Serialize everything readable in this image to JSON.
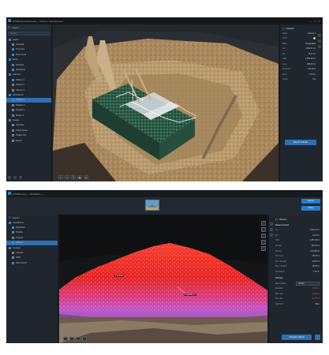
{
  "shot1": {
    "title": "PIX4Dcloud Advanced — Volume measurement",
    "window_controls": [
      "–",
      "□",
      "×"
    ],
    "left_panel": {
      "tab_label": "Layers",
      "search_placeholder": "Search",
      "tree": [
        {
          "label": "Layers",
          "level": 0,
          "checked": true,
          "section": true
        },
        {
          "label": "Imported",
          "level": 1,
          "checked": false
        },
        {
          "label": "Tie points",
          "level": 1,
          "checked": true
        },
        {
          "label": "Point cloud",
          "level": 1,
          "checked": true
        },
        {
          "label": "Mesh",
          "level": 0,
          "checked": true,
          "section": true
        },
        {
          "label": "Textured",
          "level": 1,
          "checked": true
        },
        {
          "label": "Wireframe",
          "level": 1,
          "checked": false
        },
        {
          "label": "Volumes",
          "level": 0,
          "checked": true,
          "section": true
        },
        {
          "label": "Volume 1",
          "level": 1,
          "checked": true
        },
        {
          "label": "Volume 2",
          "level": 1,
          "checked": false
        },
        {
          "label": "Volume 3",
          "level": 1,
          "checked": false
        },
        {
          "label": "Annotations",
          "level": 0,
          "checked": true,
          "section": true
        },
        {
          "label": "Polyline 1",
          "level": 1,
          "checked": true,
          "selected": true
        },
        {
          "label": "Polyline 2",
          "level": 1,
          "checked": false
        },
        {
          "label": "Polygon 1",
          "level": 1,
          "checked": false
        },
        {
          "label": "Marker 1",
          "level": 1,
          "checked": false
        },
        {
          "label": "Images",
          "level": 0,
          "checked": true,
          "section": true
        },
        {
          "label": "Cameras",
          "level": 1,
          "checked": false
        },
        {
          "label": "Orthomosaic",
          "level": 1,
          "checked": false
        },
        {
          "label": "Project info",
          "level": 1,
          "checked": false
        },
        {
          "label": "Export",
          "level": 1,
          "checked": false
        }
      ]
    },
    "viewer_tools": [
      "▸",
      "✦",
      "☰",
      "▣",
      "⊕"
    ],
    "right_panel": {
      "title": "Volume",
      "properties": [
        {
          "k": "Name",
          "v": "Volume 1"
        },
        {
          "k": "Color",
          "v": ""
        },
        {
          "k": "Base",
          "v": "Triangulated"
        },
        {
          "k": "Cut",
          "v": "2 840.31 m³"
        },
        {
          "k": "Fill",
          "v": "12.07 m³"
        },
        {
          "k": "Total",
          "v": "2 852.38 m³"
        },
        {
          "k": "Area",
          "v": "965.25 m²"
        },
        {
          "k": "Perimeter",
          "v": "126.40 m"
        },
        {
          "k": "Error",
          "v": "± 3.5 m³"
        },
        {
          "k": "Visible",
          "v": "Yes"
        }
      ],
      "action_label": "Export volume"
    }
  },
  "shot2": {
    "title": "PIX4Dsurvey — Stockpile — ...",
    "header_buttons": [
      "Export",
      "Share"
    ],
    "left_panel": {
      "tab_label": "Layers",
      "tree": [
        {
          "label": "Annotations",
          "level": 0,
          "section": true,
          "checked": true
        },
        {
          "label": "Inspection",
          "level": 1,
          "checked": true
        },
        {
          "label": "Polyline",
          "level": 1,
          "checked": false
        },
        {
          "label": "Polygon",
          "level": 1,
          "checked": false
        },
        {
          "label": "Volume",
          "level": 1,
          "checked": true,
          "selected": true
        },
        {
          "label": "Geotags",
          "level": 0,
          "section": true,
          "checked": true
        },
        {
          "label": "Camera",
          "level": 1,
          "checked": false
        },
        {
          "label": "DSM",
          "level": 1,
          "checked": false
        },
        {
          "label": "Point Cloud",
          "level": 1,
          "checked": true
        }
      ]
    },
    "viewer": {
      "labels": [
        "1 239.65 m³",
        "Cut area"
      ]
    },
    "right_panel": {
      "title": "Volume",
      "section_title": "Measurements",
      "rows": [
        {
          "k": "Cut",
          "v": "2 840.31 m³",
          "red": false
        },
        {
          "k": "Fill",
          "v": "12.07 m³",
          "red": false
        },
        {
          "k": "Total",
          "v": "2 852.38 m³",
          "red": false
        },
        {
          "k": "2D area",
          "v": "965.25 m²",
          "red": false
        },
        {
          "k": "3D area",
          "v": "1 024.88 m²",
          "red": false
        },
        {
          "k": "Perimeter",
          "v": "126.40 m",
          "red": false
        },
        {
          "k": "Min. elevation",
          "v": "415.04 m",
          "red": false
        },
        {
          "k": "Max. elevation",
          "v": "430.58 m",
          "red": false
        },
        {
          "k": "Uncertainty",
          "v": "± 3.5 m³",
          "red": false
        }
      ],
      "settings_title": "Settings",
      "settings": [
        {
          "k": "Base surface",
          "v": "Custom",
          "type": "dropdown"
        },
        {
          "k": "Elevation",
          "v": "415.04 m",
          "type": "value",
          "red": true
        },
        {
          "k": "Max. elev.",
          "v": "430.58 m",
          "type": "value",
          "red": true
        },
        {
          "k": "Min. elev.",
          "v": "415.04 m",
          "type": "value",
          "red": true
        },
        {
          "k": "Alignment",
          "v": "Base",
          "type": "value",
          "red": false
        }
      ],
      "action_label": "Compute volume"
    }
  },
  "colors": {
    "app_bg": "#1c2228",
    "panel": "#1f262d",
    "accent": "#2f6fb1",
    "heat_red": "#e42a2a",
    "heat_magenta": "#c64fd1"
  }
}
